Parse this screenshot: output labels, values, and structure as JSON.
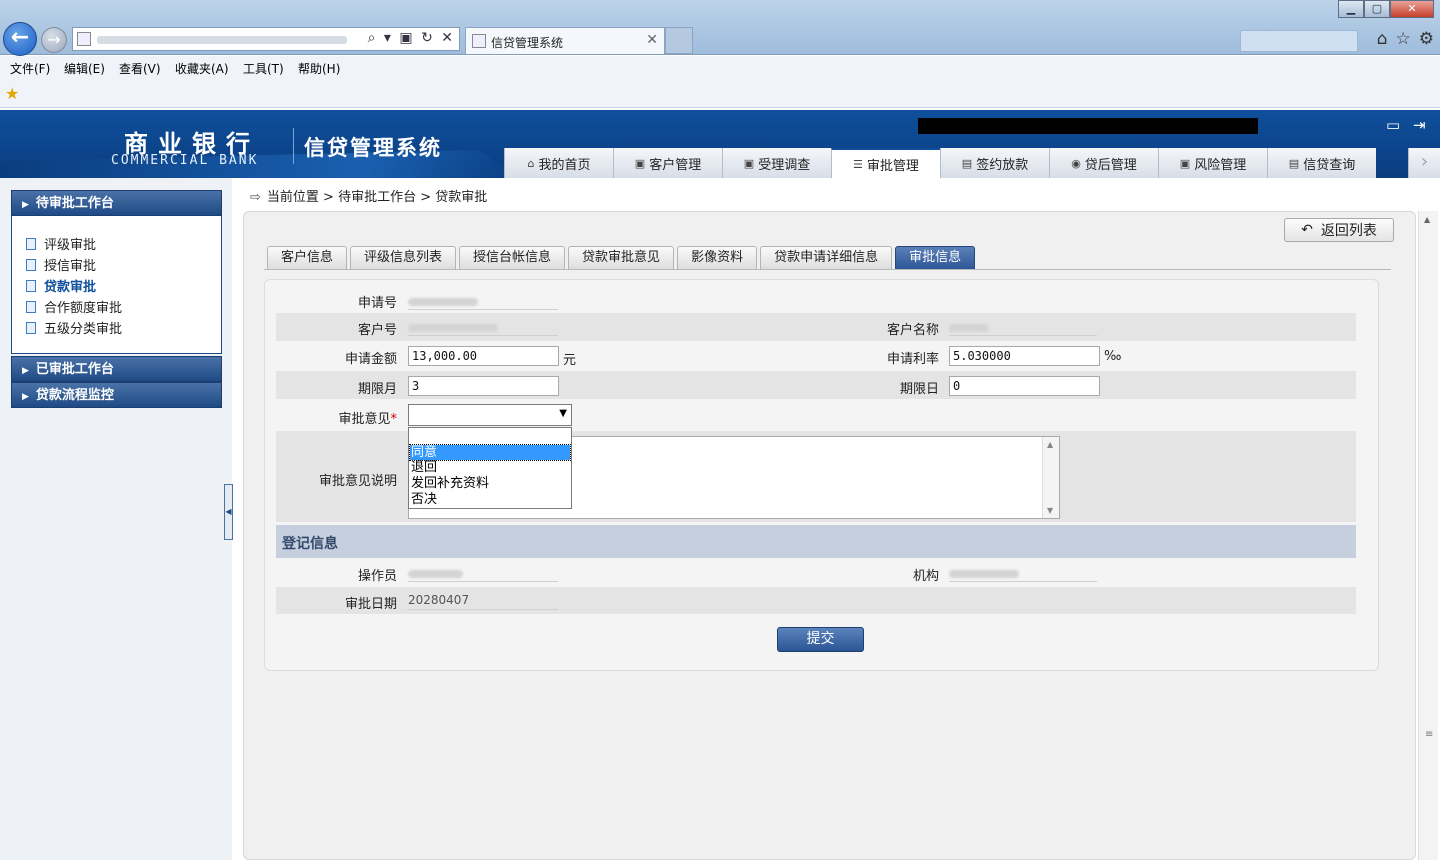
{
  "browser": {
    "tab_title": "信贷管理系统",
    "menu": [
      "文件(F)",
      "编辑(E)",
      "查看(V)",
      "收藏夹(A)",
      "工具(T)",
      "帮助(H)"
    ],
    "back_glyph": "←",
    "forward_glyph": "→",
    "addr_tools": "⌕ ▾ ▣ ↻ ✕",
    "tab_close": "✕",
    "window": {
      "min": "▁",
      "max": "▢",
      "close": "✕"
    },
    "right_icons": [
      "⌂",
      "☆",
      "⚙"
    ]
  },
  "header": {
    "bank_name_cn": "商业银行",
    "bank_name_en": "COMMERCIAL BANK",
    "system_title": "信贷管理系统"
  },
  "nav": {
    "items": [
      {
        "label": "我的首页",
        "icon": "home-icon",
        "glyph": "⌂"
      },
      {
        "label": "客户管理",
        "icon": "customer-icon",
        "glyph": "▣"
      },
      {
        "label": "受理调查",
        "icon": "survey-icon",
        "glyph": "▣"
      },
      {
        "label": "审批管理",
        "icon": "approval-icon",
        "glyph": "☰"
      },
      {
        "label": "签约放款",
        "icon": "contract-icon",
        "glyph": "▤"
      },
      {
        "label": "贷后管理",
        "icon": "postloan-icon",
        "glyph": "◉"
      },
      {
        "label": "风险管理",
        "icon": "risk-icon",
        "glyph": "▣"
      },
      {
        "label": "信贷查询",
        "icon": "query-icon",
        "glyph": "▤"
      }
    ],
    "active": "审批管理",
    "more_glyph": "›"
  },
  "sidebar": {
    "sections": [
      {
        "label": "待审批工作台",
        "expanded": true
      },
      {
        "label": "已审批工作台",
        "expanded": false
      },
      {
        "label": "贷款流程监控",
        "expanded": false
      }
    ],
    "links": [
      "评级审批",
      "授信审批",
      "贷款审批",
      "合作额度审批",
      "五级分类审批"
    ],
    "current": "贷款审批"
  },
  "breadcrumb": {
    "icon_glyph": "⇨",
    "text": "当前位置 > 待审批工作台 > 贷款审批"
  },
  "actions": {
    "back_to_list": "返回列表",
    "back_glyph": "↶",
    "submit": "提交"
  },
  "subtabs": {
    "items": [
      "客户信息",
      "评级信息列表",
      "授信台帐信息",
      "贷款审批意见",
      "影像资料",
      "贷款申请详细信息",
      "审批信息"
    ],
    "active": "审批信息"
  },
  "form": {
    "application_no_label": "申请号",
    "customer_no_label": "客户号",
    "customer_name_label": "客户名称",
    "amount_label": "申请金额",
    "amount_value": "13,000.00",
    "amount_unit": "元",
    "rate_label": "申请利率",
    "rate_value": "5.030000",
    "rate_unit": "‰",
    "term_month_label": "期限月",
    "term_month_value": "3",
    "term_day_label": "期限日",
    "term_day_value": "0",
    "opinion_label": "审批意见",
    "required_mark": "*",
    "opinion_selected": "",
    "opinion_options": [
      "",
      "同意",
      "退回",
      "发回补充资料",
      "否决"
    ],
    "opinion_highlight": "同意",
    "opinion_desc_label": "审批意见说明"
  },
  "registration": {
    "title": "登记信息",
    "operator_label": "操作员",
    "org_label": "机构",
    "date_label": "审批日期",
    "date_value": "20280407"
  }
}
